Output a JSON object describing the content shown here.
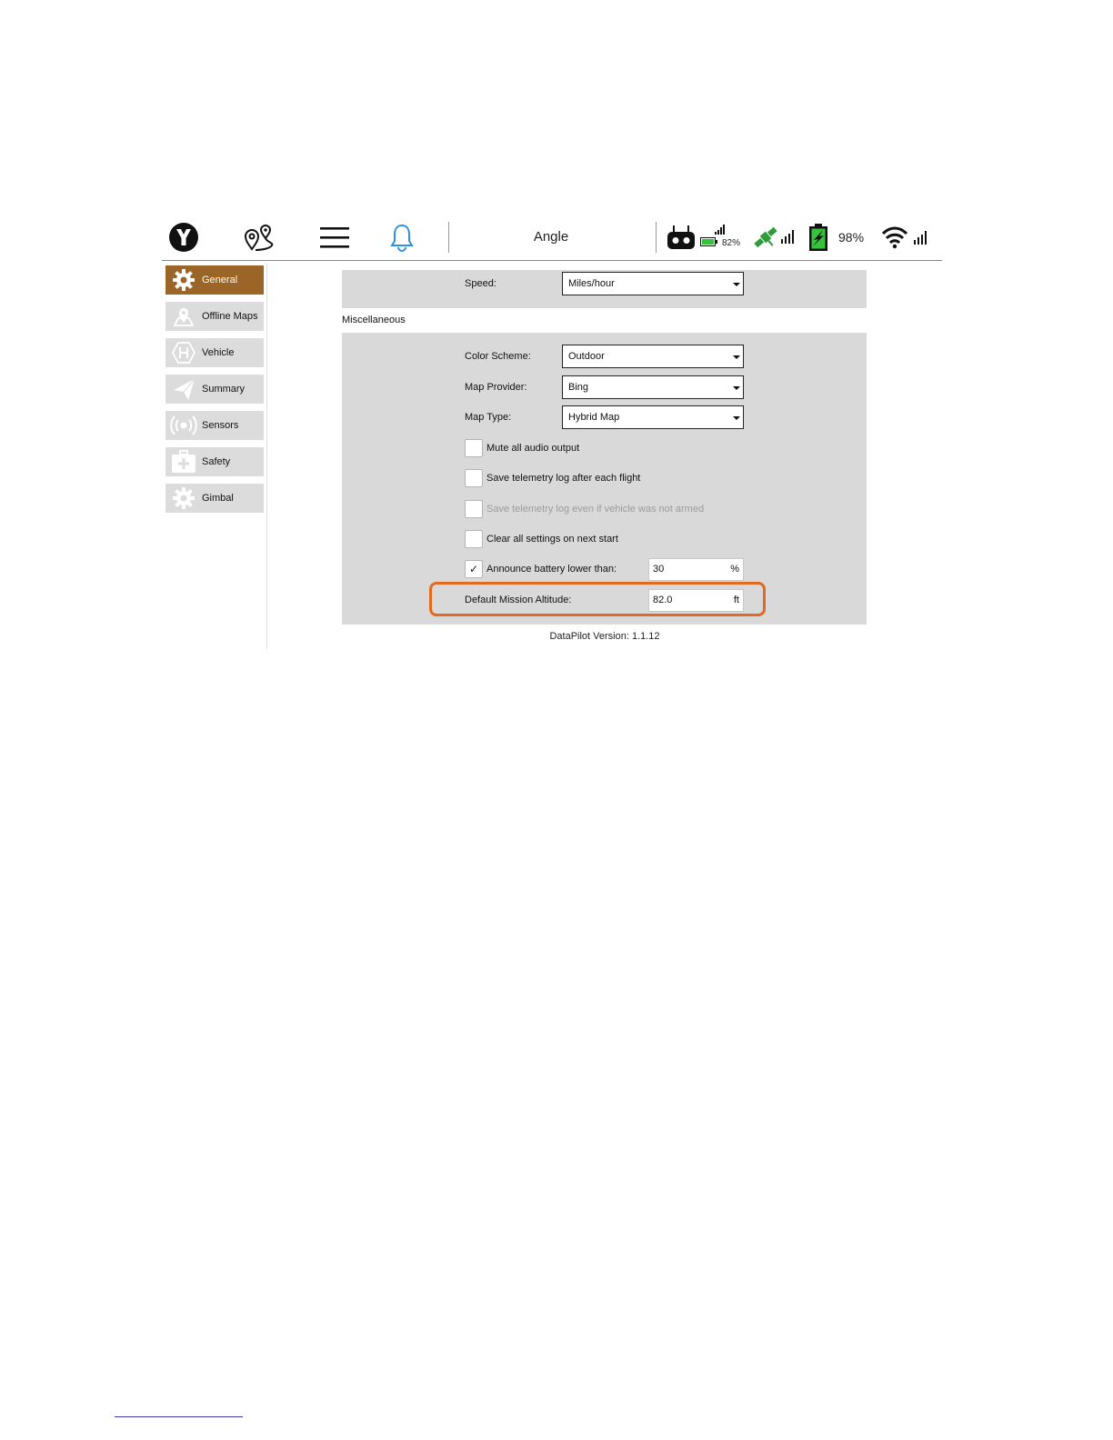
{
  "toolbar": {
    "mode": "Angle",
    "rc_battery": "82%",
    "vehicle_battery": "98%",
    "icons": [
      "app-logo-icon",
      "plan-route-icon",
      "menu-icon",
      "bell-icon",
      "remote-controller-icon",
      "battery-icon",
      "signal-icon",
      "gps-icon",
      "vehicle-battery-icon",
      "wifi-icon"
    ],
    "colors": {
      "bell": "#2f8fe0",
      "gps": "#2e9c3a",
      "battery_fill": "#36c23a"
    }
  },
  "sidebar": {
    "items": [
      {
        "label": "General",
        "icon": "gear-icon",
        "active": true
      },
      {
        "label": "Offline Maps",
        "icon": "map-pin-icon",
        "active": false
      },
      {
        "label": "Vehicle",
        "icon": "vehicle-icon",
        "active": false
      },
      {
        "label": "Summary",
        "icon": "paper-plane-icon",
        "active": false
      },
      {
        "label": "Sensors",
        "icon": "sensor-icon",
        "active": false
      },
      {
        "label": "Safety",
        "icon": "first-aid-icon",
        "active": false
      },
      {
        "label": "Gimbal",
        "icon": "gear-icon",
        "active": false
      }
    ],
    "active_color": "#9a6526"
  },
  "units": {
    "speed_label": "Speed:",
    "speed_value": "Miles/hour"
  },
  "misc": {
    "heading": "Miscellaneous",
    "color_scheme_label": "Color Scheme:",
    "color_scheme_value": "Outdoor",
    "map_provider_label": "Map Provider:",
    "map_provider_value": "Bing",
    "map_type_label": "Map Type:",
    "map_type_value": "Hybrid Map",
    "checkboxes": [
      {
        "label": "Mute all audio output",
        "checked": false,
        "enabled": true
      },
      {
        "label": "Save telemetry log after each flight",
        "checked": false,
        "enabled": true
      },
      {
        "label": "Save telemetry log even if vehicle was not armed",
        "checked": false,
        "enabled": false
      },
      {
        "label": "Clear all settings on next start",
        "checked": false,
        "enabled": true
      },
      {
        "label": "Announce battery lower than:",
        "checked": true,
        "enabled": true
      }
    ],
    "check_mark": "✓",
    "battery_threshold_value": "30",
    "battery_threshold_unit": "%",
    "altitude_label": "Default Mission Altitude:",
    "altitude_value": "82.0",
    "altitude_unit": "ft",
    "highlight_color": "#e06a1f"
  },
  "footer": {
    "version": "DataPilot Version: 1.1.12"
  }
}
